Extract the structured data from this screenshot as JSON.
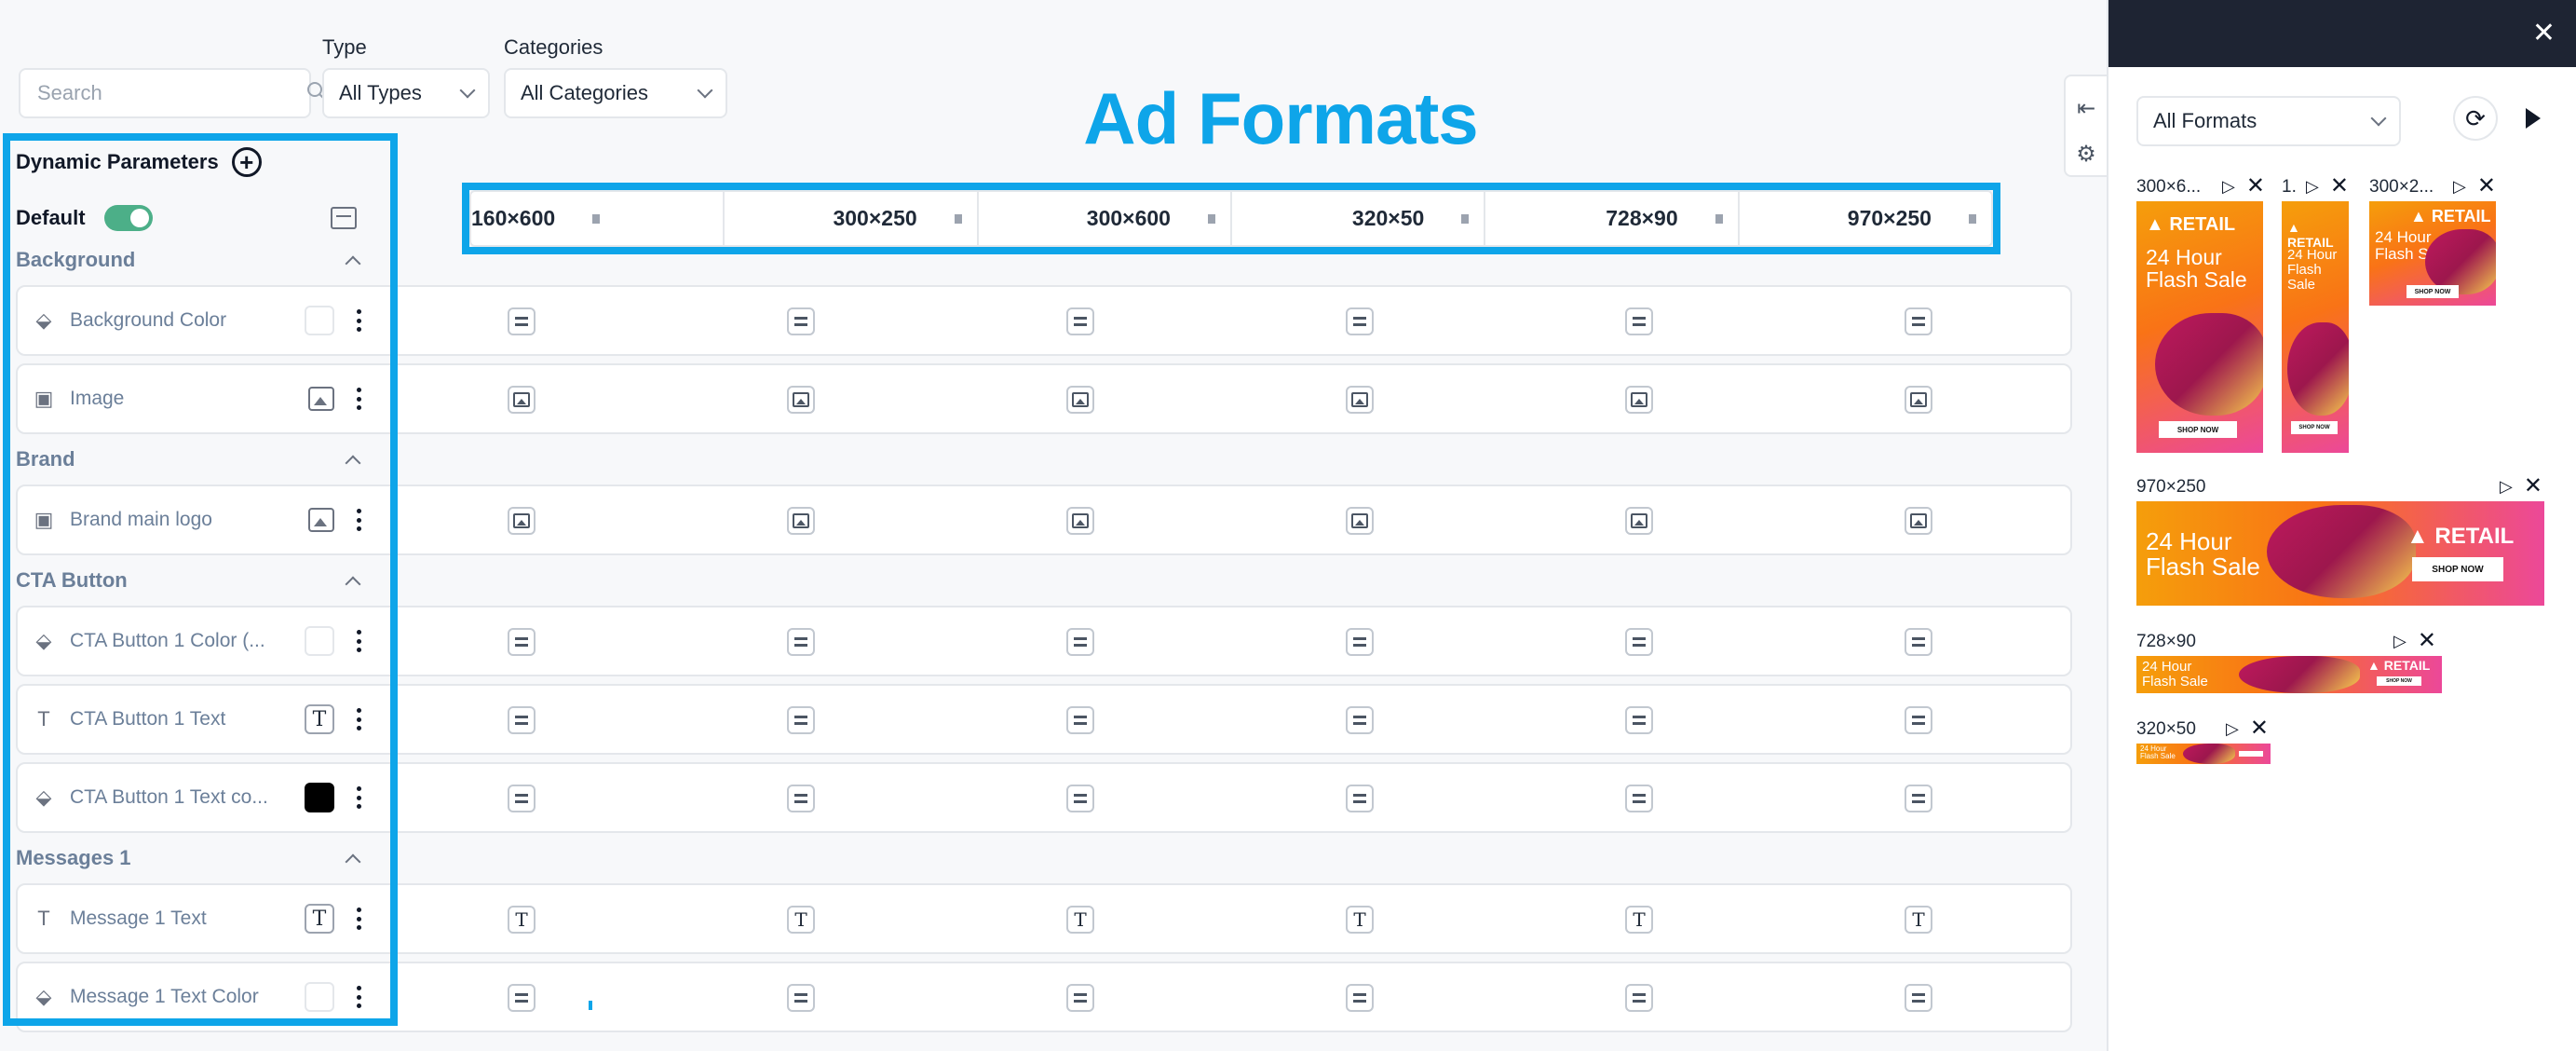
{
  "filters": {
    "search_placeholder": "Search",
    "type_label": "Type",
    "type_value": "All Types",
    "categories_label": "Categories",
    "categories_value": "All Categories"
  },
  "page_title": "Ad Formats",
  "params": {
    "header": "Dynamic Parameters",
    "default_label": "Default",
    "default_enabled": true
  },
  "formats": [
    "160×600",
    "300×250",
    "300×600",
    "320×50",
    "728×90",
    "970×250"
  ],
  "groups": [
    {
      "title": "Background",
      "rows": [
        {
          "name": "Background Color",
          "icon": "paint-bucket-icon",
          "value_kind": "color",
          "value": "#ffffff",
          "cell": "equals"
        },
        {
          "name": "Image",
          "icon": "image-icon",
          "value_kind": "image",
          "cell": "image"
        }
      ]
    },
    {
      "title": "Brand",
      "rows": [
        {
          "name": "Brand main logo",
          "icon": "image-icon",
          "value_kind": "image",
          "cell": "image"
        }
      ]
    },
    {
      "title": "CTA Button",
      "rows": [
        {
          "name": "CTA Button 1 Color (...",
          "icon": "paint-bucket-icon",
          "value_kind": "color",
          "value": "#ffffff",
          "cell": "equals"
        },
        {
          "name": "CTA Button 1 Text",
          "icon": "text-icon",
          "value_kind": "text",
          "cell": "equals"
        },
        {
          "name": "CTA Button 1 Text co...",
          "icon": "paint-bucket-icon",
          "value_kind": "color",
          "value": "#000000",
          "cell": "equals"
        }
      ]
    },
    {
      "title": "Messages 1",
      "rows": [
        {
          "name": "Message 1 Text",
          "icon": "text-icon",
          "value_kind": "text",
          "cell": "text"
        },
        {
          "name": "Message 1 Text Color",
          "icon": "paint-bucket-icon",
          "value_kind": "color",
          "value": "#ffffff",
          "cell": "equals"
        }
      ]
    }
  ],
  "preview": {
    "select_value": "All Formats",
    "labels": {
      "p300x600": "300×6...",
      "p160x600": "1.",
      "p300x250": "300×2...",
      "p970x250": "970×250",
      "p728x90": "728×90",
      "p320x50": "320×50"
    },
    "ad_brand": "RETAIL",
    "ad_headline_lines": [
      "24 Hour",
      "Flash Sale"
    ],
    "ad_cta": "SHOP NOW"
  },
  "colors": {
    "accent": "#0ea5e9",
    "toggle_on": "#4caf88",
    "panel_header": "#1e2433"
  }
}
